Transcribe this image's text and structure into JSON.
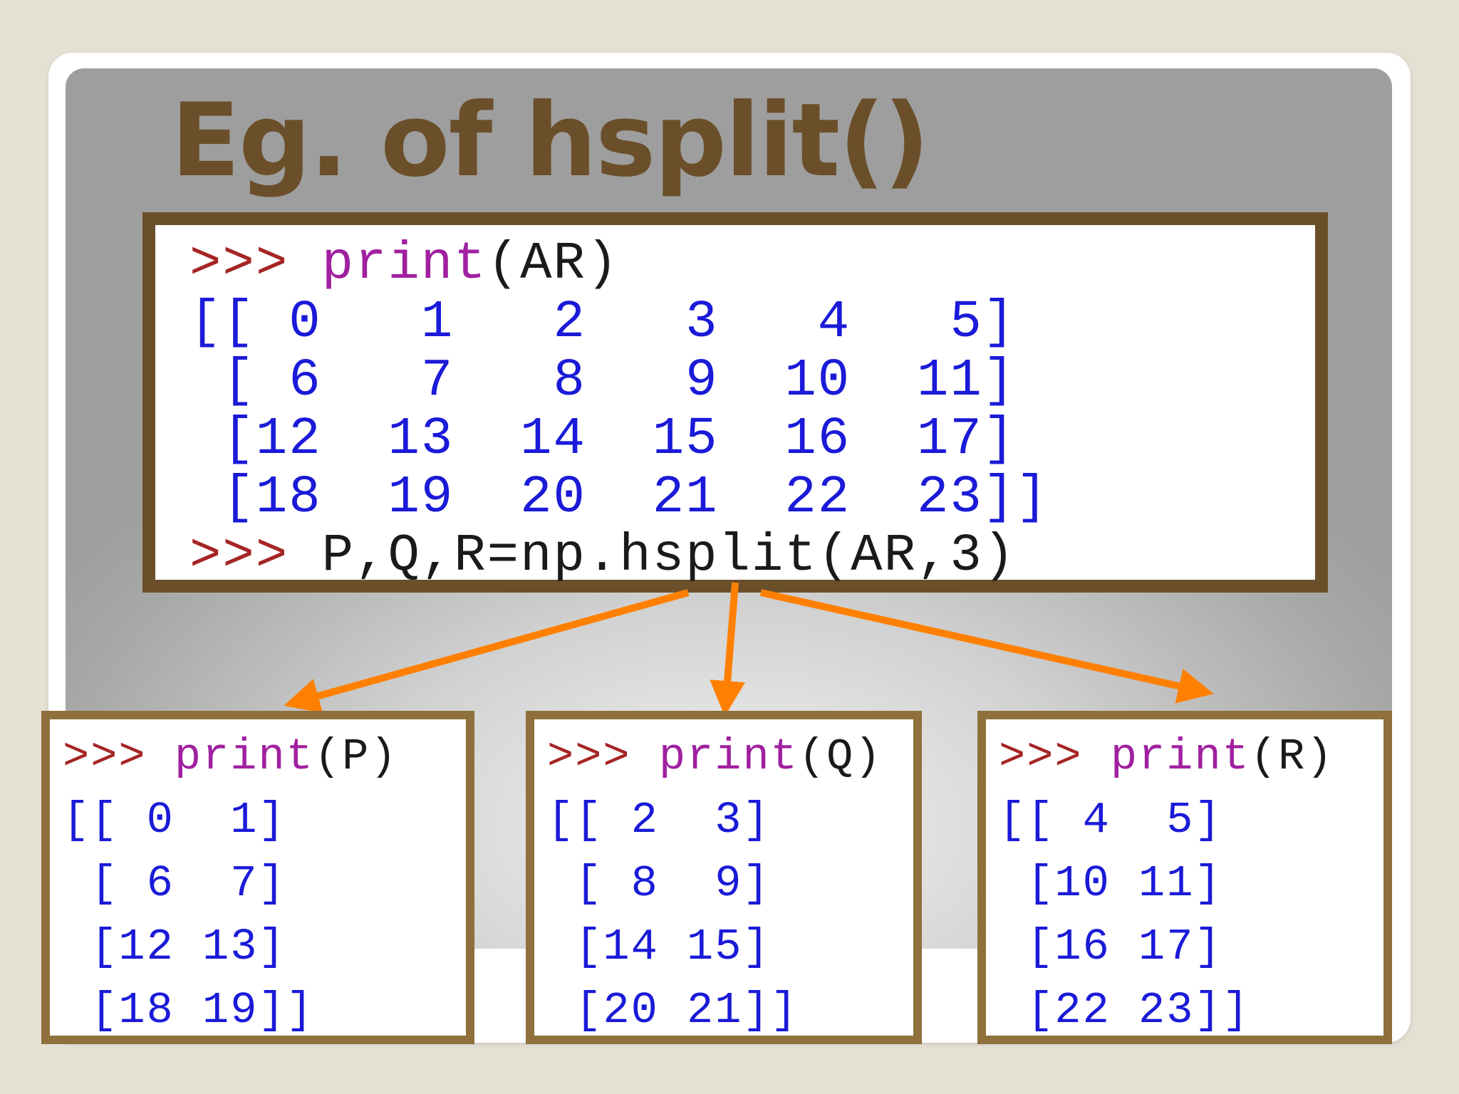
{
  "title": "Eg. of hsplit()",
  "colors": {
    "title": "#6b4f2a",
    "main_border": "#6b4f2a",
    "sub_border": "#8f6f3c",
    "arrow": "#ff8000",
    "prompt": "#a52525",
    "keyword": "#a020a0",
    "output": "#1a1ad8"
  },
  "main_console": {
    "prompt1": ">>> ",
    "cmd1_kw": "print",
    "cmd1_rest": "(AR)",
    "output": "[[ 0   1   2   3   4   5]\n [ 6   7   8   9  10  11]\n [12  13  14  15  16  17]\n [18  19  20  21  22  23]]",
    "prompt2": ">>> ",
    "cmd2": "P,Q,R=np.hsplit(AR,3)"
  },
  "split_consoles": [
    {
      "prompt": ">>> ",
      "cmd_kw": "print",
      "cmd_rest": "(P)",
      "output": "[[ 0  1]\n [ 6  7]\n [12 13]\n [18 19]]"
    },
    {
      "prompt": ">>> ",
      "cmd_kw": "print",
      "cmd_rest": "(Q)",
      "output": "[[ 2  3]\n [ 8  9]\n [14 15]\n [20 21]]"
    },
    {
      "prompt": ">>> ",
      "cmd_kw": "print",
      "cmd_rest": "(R)",
      "output": "[[ 4  5]\n [10 11]\n [16 17]\n [22 23]]"
    }
  ]
}
